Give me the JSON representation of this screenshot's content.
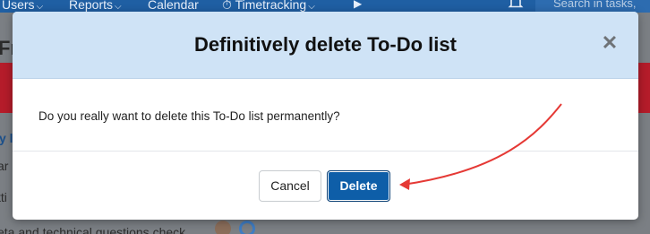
{
  "nav": {
    "items": [
      {
        "label": "Users",
        "caret": "⌵"
      },
      {
        "label": "Reports",
        "caret": "⌵"
      },
      {
        "label": "Calendar",
        "caret": ""
      },
      {
        "label": "Timetracking",
        "caret": "⌵"
      }
    ],
    "search_placeholder": "Search in tasks,"
  },
  "background": {
    "title_fragment": "Fro",
    "link_fragment": "y l",
    "line1": "ar",
    "line2": "tti",
    "line3": "eta and technical questions check"
  },
  "modal": {
    "title": "Definitively delete To-Do list",
    "close_glyph": "✕",
    "message": "Do you really want to delete this To-Do list permanently?",
    "cancel_label": "Cancel",
    "delete_label": "Delete"
  },
  "colors": {
    "nav_bg": "#1f5fa3",
    "modal_header_bg": "#cfe3f6",
    "delete_button_bg": "#0e5ea8",
    "alert_red": "#b51c2a",
    "annotation_arrow": "#e53935"
  }
}
